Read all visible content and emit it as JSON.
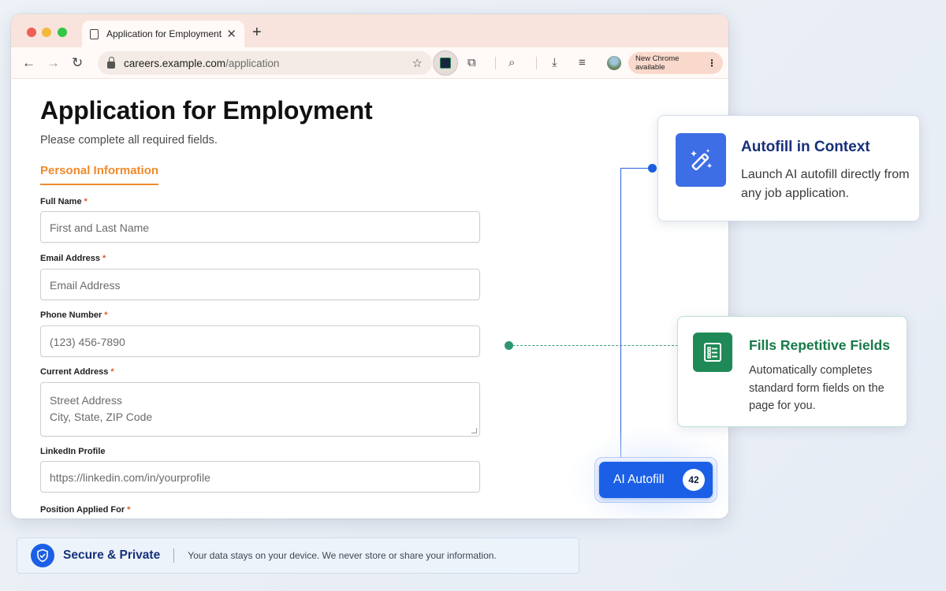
{
  "browser": {
    "tab_title": "Application for Employment",
    "url_host": "careers.example.com",
    "url_path": "/application",
    "update_label": "New Chrome available"
  },
  "form": {
    "title": "Application for Employment",
    "subtitle": "Please complete all required fields.",
    "section": "Personal Information",
    "required_mark": "*",
    "fields": [
      {
        "label": "Full Name",
        "placeholder": "First and Last Name"
      },
      {
        "label": "Email Address",
        "placeholder": "Email Address"
      },
      {
        "label": "Phone Number",
        "placeholder": "(123) 456-7890"
      },
      {
        "label": "Current Address",
        "placeholder_line1": "Street Address",
        "placeholder_line2": "City, State, ZIP Code"
      },
      {
        "label": "LinkedIn Profile",
        "placeholder": "https://linkedin.com/in/yourprofile"
      },
      {
        "label": "Position Applied For"
      }
    ]
  },
  "autofill_button": {
    "label": "AI Autofill",
    "count": "42"
  },
  "callouts": [
    {
      "title": "Autofill in Context",
      "text": "Launch AI autofill directly from any job application."
    },
    {
      "title": "Fills Repetitive Fields",
      "text": "Automatically completes standard form fields on the page for you."
    }
  ],
  "security": {
    "title": "Secure & Private",
    "text": "Your data stays on your device. We never store or share your information."
  },
  "colors": {
    "accent_blue": "#1b5fe6",
    "accent_orange": "#ef8a2c",
    "accent_green": "#1f8a57",
    "tabbar": "#f8e4dc"
  }
}
